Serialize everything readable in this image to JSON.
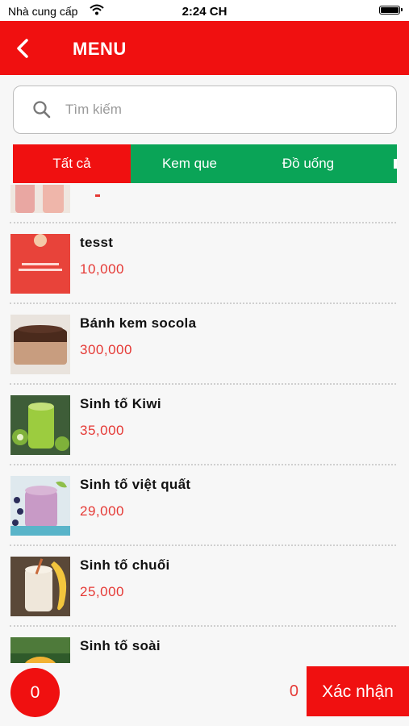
{
  "status_bar": {
    "carrier": "Nhà cung cấp",
    "time": "2:24 CH"
  },
  "header": {
    "title": "MENU"
  },
  "search": {
    "placeholder": "Tìm kiếm",
    "value": ""
  },
  "tabs": [
    {
      "label": "Tất cả",
      "active": true
    },
    {
      "label": "Kem que",
      "active": false
    },
    {
      "label": "Đồ uống",
      "active": false
    }
  ],
  "items": [
    {
      "name": "",
      "price": "",
      "image": "drink-pink"
    },
    {
      "name": "tesst",
      "price": "10,000",
      "image": "red-card"
    },
    {
      "name": "Bánh kem socola",
      "price": "300,000",
      "image": "chocolate-cake"
    },
    {
      "name": "Sinh tố Kiwi",
      "price": "35,000",
      "image": "kiwi-smoothie"
    },
    {
      "name": "Sinh tố việt quất",
      "price": "29,000",
      "image": "blueberry-smoothie"
    },
    {
      "name": "Sinh tố chuối",
      "price": "25,000",
      "image": "banana-smoothie"
    },
    {
      "name": "Sinh tố soài",
      "price": "",
      "image": "mango-smoothie"
    }
  ],
  "cart": {
    "count": "0",
    "total": "0"
  },
  "actions": {
    "confirm_label": "Xác nhận"
  },
  "colors": {
    "primary_red": "#f01010",
    "tab_green": "#0aa457",
    "price_red": "#e53935"
  }
}
